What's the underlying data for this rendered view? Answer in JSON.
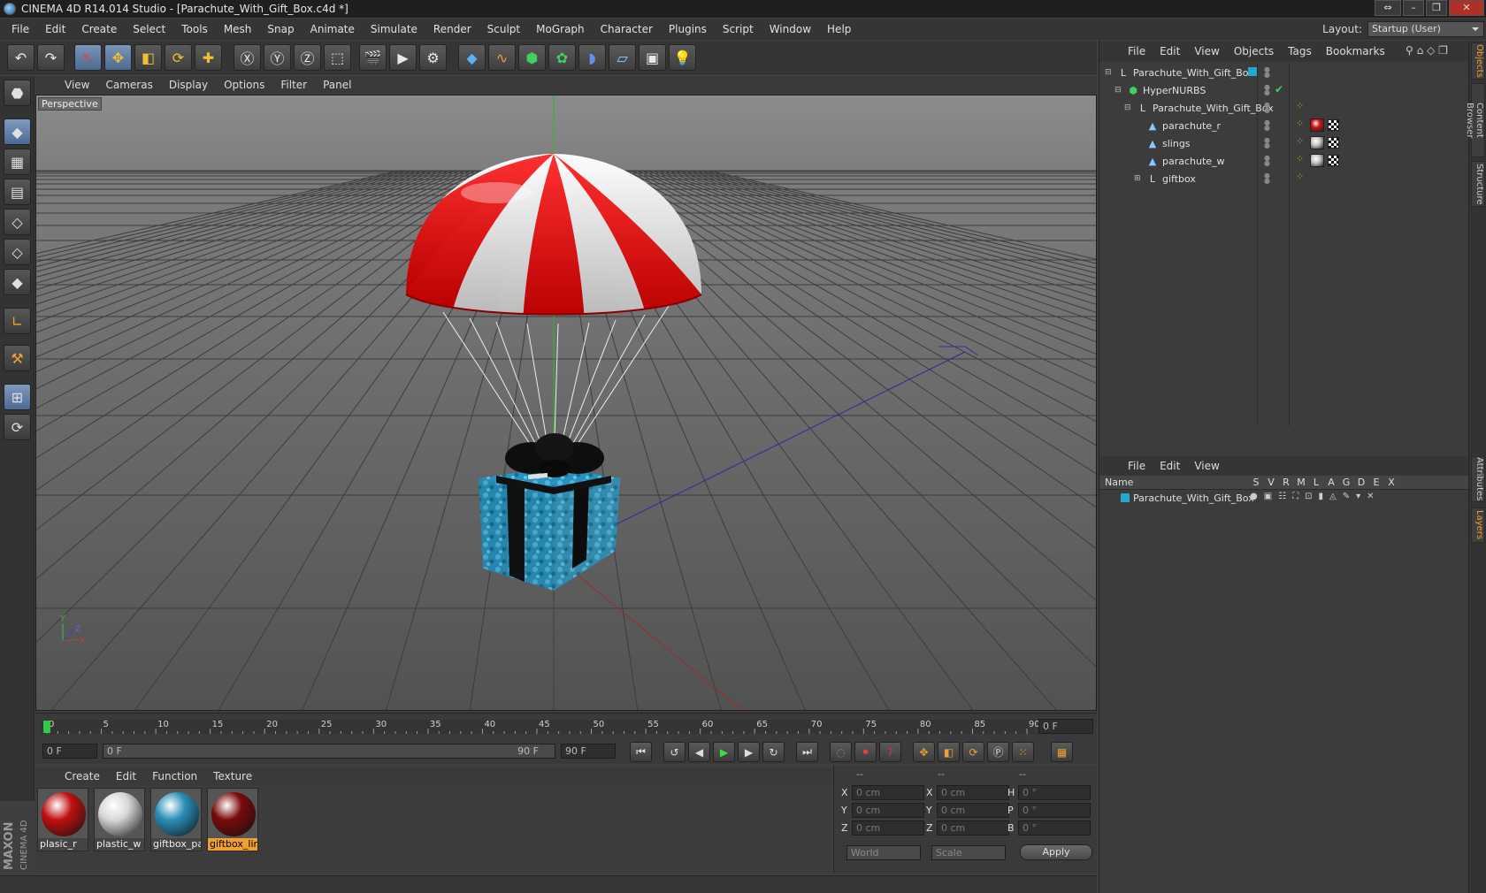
{
  "window": {
    "title": "CINEMA 4D R14.014 Studio - [Parachute_With_Gift_Box.c4d *]",
    "buttons": [
      "⇔",
      "–",
      "❐",
      "✕"
    ]
  },
  "menubar": [
    "File",
    "Edit",
    "Create",
    "Select",
    "Tools",
    "Mesh",
    "Snap",
    "Animate",
    "Simulate",
    "Render",
    "Sculpt",
    "MoGraph",
    "Character",
    "Plugins",
    "Script",
    "Window",
    "Help"
  ],
  "layout": {
    "label": "Layout:",
    "value": "Startup (User)"
  },
  "toolbar": {
    "buttons": [
      "undo-icon",
      "redo-icon",
      "live-selection-icon",
      "move-icon",
      "scale-icon",
      "rotate-icon",
      "add-object-icon",
      "x-axis-icon",
      "y-axis-icon",
      "z-axis-icon",
      "coordinate-system-icon",
      "render-view-icon",
      "render-picture-viewer-icon",
      "edit-render-settings-icon",
      "cube-icon",
      "spline-icon",
      "nurbs-icon",
      "array-icon",
      "deformer-icon",
      "floor-icon",
      "camera-icon",
      "light-icon"
    ]
  },
  "lefttools": [
    "make-editable-icon",
    "model-mode-icon",
    "texture-mode-icon",
    "workplane-icon",
    "points-mode-icon",
    "edges-mode-icon",
    "polygons-mode-icon",
    "axis-mode-icon",
    "tweak-icon",
    "snap-icon",
    "workplane-lock-icon",
    "soft-selection-icon"
  ],
  "viewport": {
    "menu": [
      "View",
      "Cameras",
      "Display",
      "Options",
      "Filter",
      "Panel"
    ],
    "label": "Perspective",
    "axis": {
      "x": "X",
      "y": "Y",
      "z": "Z"
    }
  },
  "timeline": {
    "ticks": [
      "0",
      "5",
      "10",
      "15",
      "20",
      "25",
      "30",
      "35",
      "40",
      "45",
      "50",
      "55",
      "60",
      "65",
      "70",
      "75",
      "80",
      "85",
      "90"
    ],
    "current": "0 F"
  },
  "transport": {
    "start": "0 F",
    "range_start": "0 F",
    "range_end": "90 F",
    "end": "90 F"
  },
  "materials": {
    "menu": [
      "Create",
      "Edit",
      "Function",
      "Texture"
    ],
    "items": [
      {
        "label": "plasic_r",
        "color": "#c01010"
      },
      {
        "label": "plastic_w",
        "color": "#d8d8d8"
      },
      {
        "label": "giftbox_pa",
        "color": "#2a8fb8"
      },
      {
        "label": "giftbox_lin",
        "color": "#7a0a0a"
      }
    ]
  },
  "coords": {
    "headers": [
      "--",
      "--",
      "--"
    ],
    "rows": [
      {
        "a": "X",
        "av": "0 cm",
        "b": "X",
        "bv": "0 cm",
        "c": "H",
        "cv": "0 °"
      },
      {
        "a": "Y",
        "av": "0 cm",
        "b": "Y",
        "bv": "0 cm",
        "c": "P",
        "cv": "0 °"
      },
      {
        "a": "Z",
        "av": "0 cm",
        "b": "Z",
        "bv": "0 cm",
        "c": "B",
        "cv": "0 °"
      }
    ],
    "world": "World",
    "scale": "Scale",
    "apply": "Apply"
  },
  "branding": {
    "maxon": "MAXON",
    "cinema": "CINEMA 4D"
  },
  "objects": {
    "menu": [
      "File",
      "Edit",
      "View",
      "Objects",
      "Tags",
      "Bookmarks"
    ],
    "items": [
      {
        "name": "Parachute_With_Gift_Box",
        "indent": 0,
        "icon": "null-object-icon"
      },
      {
        "name": "HyperNURBS",
        "indent": 1,
        "icon": "hypernurbs-icon"
      },
      {
        "name": "Parachute_With_Gift_Box",
        "indent": 2,
        "icon": "null-object-icon"
      },
      {
        "name": "parachute_r",
        "indent": 3,
        "icon": "polygon-object-icon"
      },
      {
        "name": "slings",
        "indent": 3,
        "icon": "polygon-object-icon"
      },
      {
        "name": "parachute_w",
        "indent": 3,
        "icon": "polygon-object-icon"
      },
      {
        "name": "giftbox",
        "indent": 3,
        "icon": "null-object-icon"
      }
    ]
  },
  "layers": {
    "menu": [
      "File",
      "Edit",
      "View"
    ],
    "columns": [
      "Name",
      "S",
      "V",
      "R",
      "M",
      "L",
      "A",
      "G",
      "D",
      "E",
      "X"
    ],
    "rows": [
      {
        "name": "Parachute_With_Gift_Box",
        "color": "#22aacc"
      }
    ]
  },
  "sidetabs": [
    "Objects",
    "Content Browser",
    "Structure",
    "Attributes",
    "Layers"
  ],
  "colors": {
    "accent": "#f0a030",
    "selection": "#7f9bc0",
    "viewport_bg": "#5e5e5e"
  }
}
